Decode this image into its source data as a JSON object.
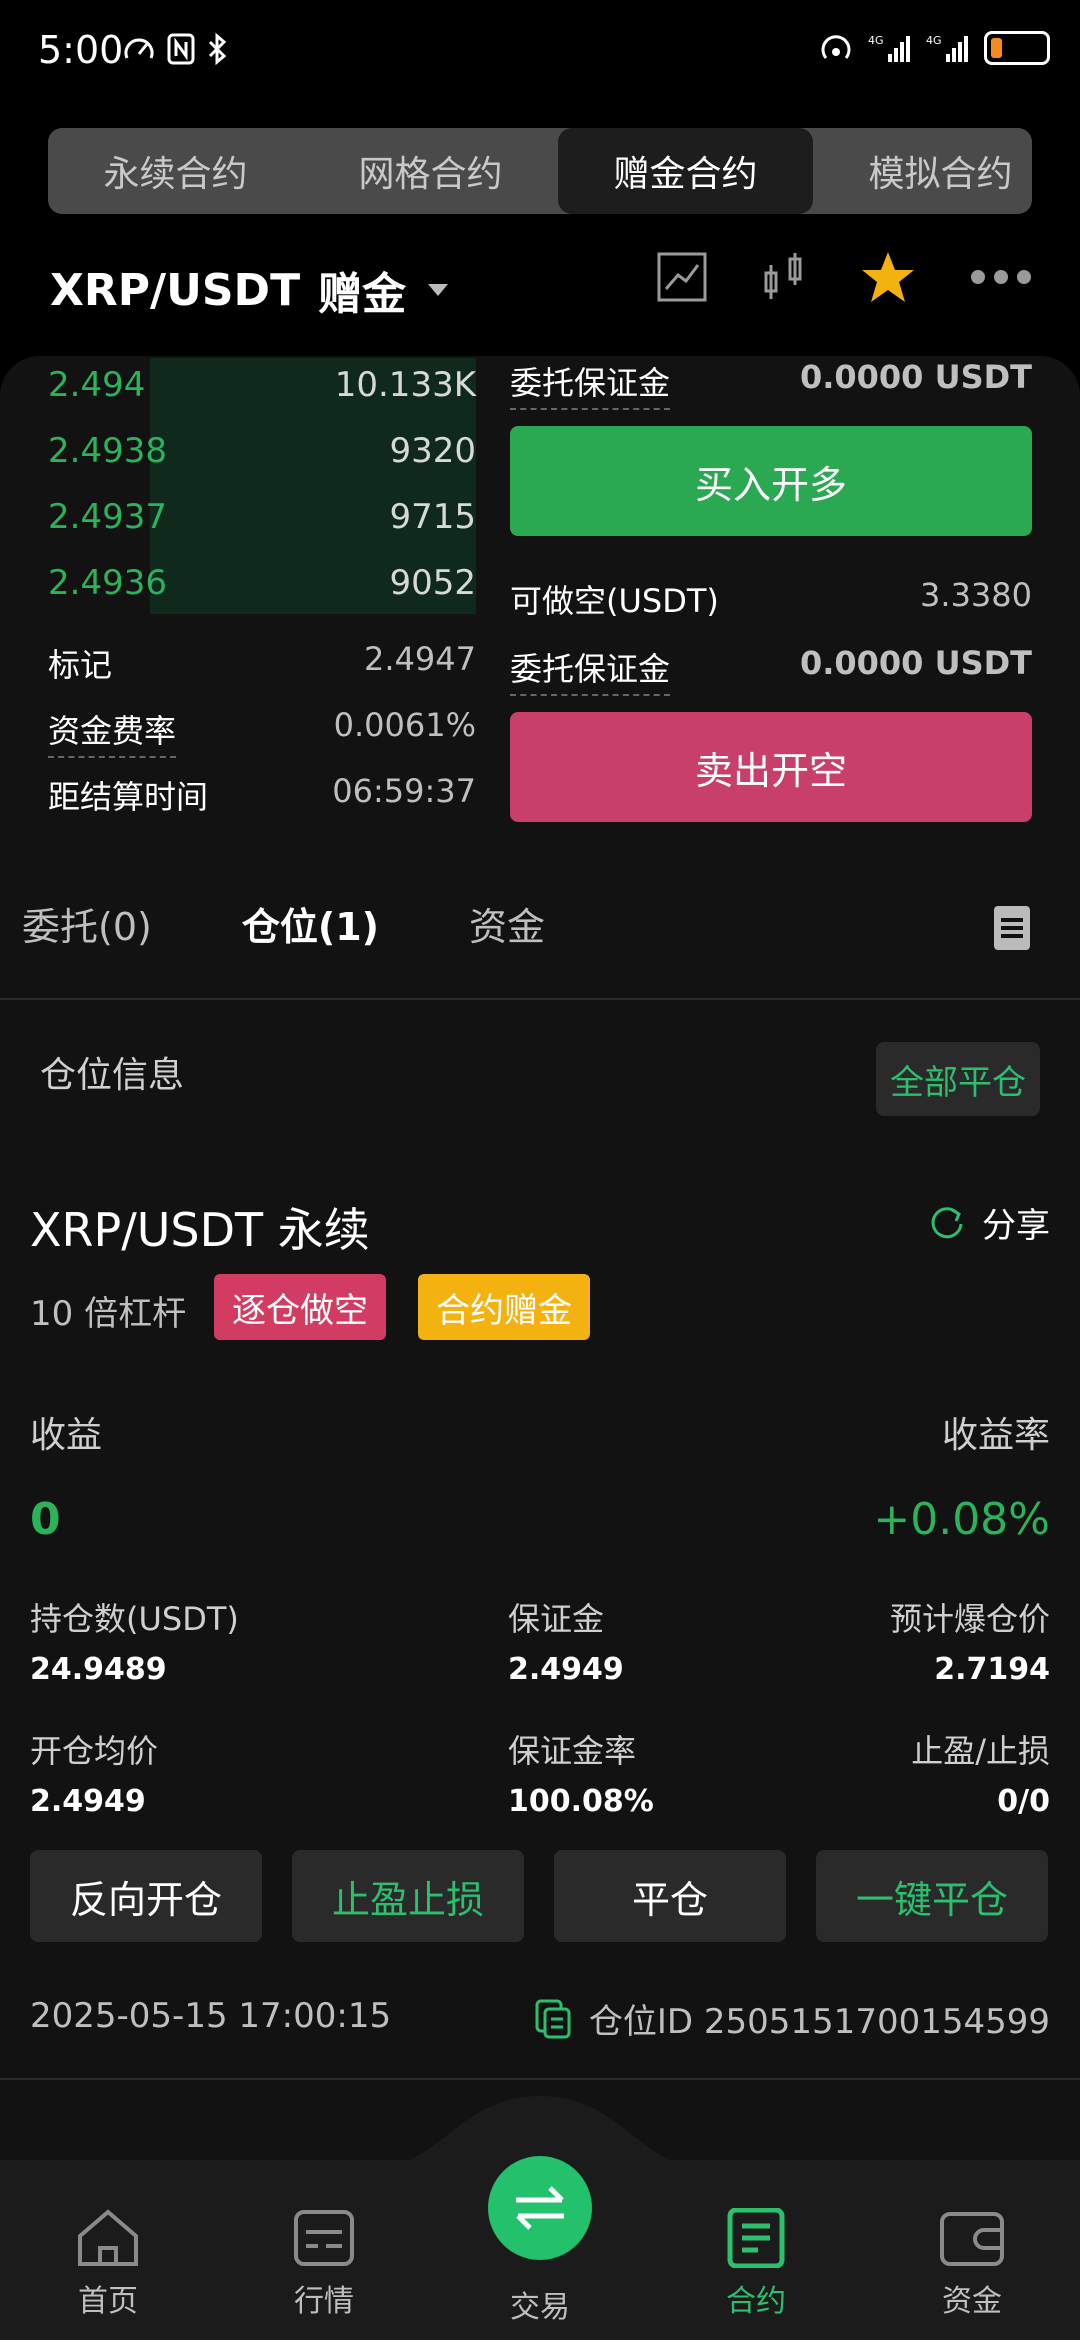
{
  "status": {
    "time": "5:00",
    "battery_level": 0.2
  },
  "mode_tabs": [
    {
      "label": "永续合约",
      "active": false
    },
    {
      "label": "网格合约",
      "active": false
    },
    {
      "label": "赠金合约",
      "active": true
    },
    {
      "label": "模拟合约",
      "active": false
    }
  ],
  "header": {
    "pair": "XRP/USDT",
    "badge": "赠金"
  },
  "orderbook": [
    {
      "price": "2.494",
      "qty": "10.133K"
    },
    {
      "price": "2.4938",
      "qty": "9320"
    },
    {
      "price": "2.4937",
      "qty": "9715"
    },
    {
      "price": "2.4936",
      "qty": "9052"
    }
  ],
  "market_info": [
    {
      "label": "标记",
      "value": "2.4947"
    },
    {
      "label": "资金费率",
      "value": "0.0061%"
    },
    {
      "label": "距结算时间",
      "value": "06:59:37"
    }
  ],
  "order_panel": {
    "margin_label": "委托保证金",
    "margin_value": "0.0000 USDT",
    "buy_label": "买入开多",
    "short_label": "可做空(USDT)",
    "short_value": "3.3380",
    "margin_label_2": "委托保证金",
    "margin_value_2": "0.0000 USDT",
    "sell_label": "卖出开空"
  },
  "position_tabs": [
    {
      "label": "委托(0)",
      "active": false
    },
    {
      "label": "仓位(1)",
      "active": true
    },
    {
      "label": "资金",
      "active": false
    }
  ],
  "position": {
    "section_title": "仓位信息",
    "close_all": "全部平仓",
    "contract": "XRP/USDT 永续",
    "share": "分享",
    "leverage": "10 倍杠杆",
    "tag_mode": "逐仓做空",
    "tag_bonus": "合约赠金",
    "pnl_label": "收益",
    "pnl_value": "0",
    "roe_label": "收益率",
    "roe_value": "+0.08%",
    "size_label": "持仓数(USDT)",
    "size_value": "24.9489",
    "margin_label": "保证金",
    "margin_value": "2.4949",
    "liq_label": "预计爆仓价",
    "liq_value": "2.7194",
    "entry_label": "开仓均价",
    "entry_value": "2.4949",
    "margin_ratio_label": "保证金率",
    "margin_ratio_value": "100.08%",
    "tpsl_label": "止盈/止损",
    "tpsl_value": "0/0",
    "actions": [
      "反向开仓",
      "止盈止损",
      "平仓",
      "一键平仓"
    ],
    "timestamp": "2025-05-15 17:00:15",
    "position_id": "仓位ID 2505151700154599"
  },
  "bottom_nav": [
    {
      "label": "首页",
      "icon": "home-icon"
    },
    {
      "label": "行情",
      "icon": "market-icon"
    },
    {
      "label": "交易",
      "icon": "trade-icon"
    },
    {
      "label": "合约",
      "icon": "contract-icon"
    },
    {
      "label": "资金",
      "icon": "wallet-icon"
    }
  ],
  "colors": {
    "green": "#2bb35c",
    "red": "#c8406a",
    "accent": "#23c16b",
    "gold": "#f3b20f"
  }
}
